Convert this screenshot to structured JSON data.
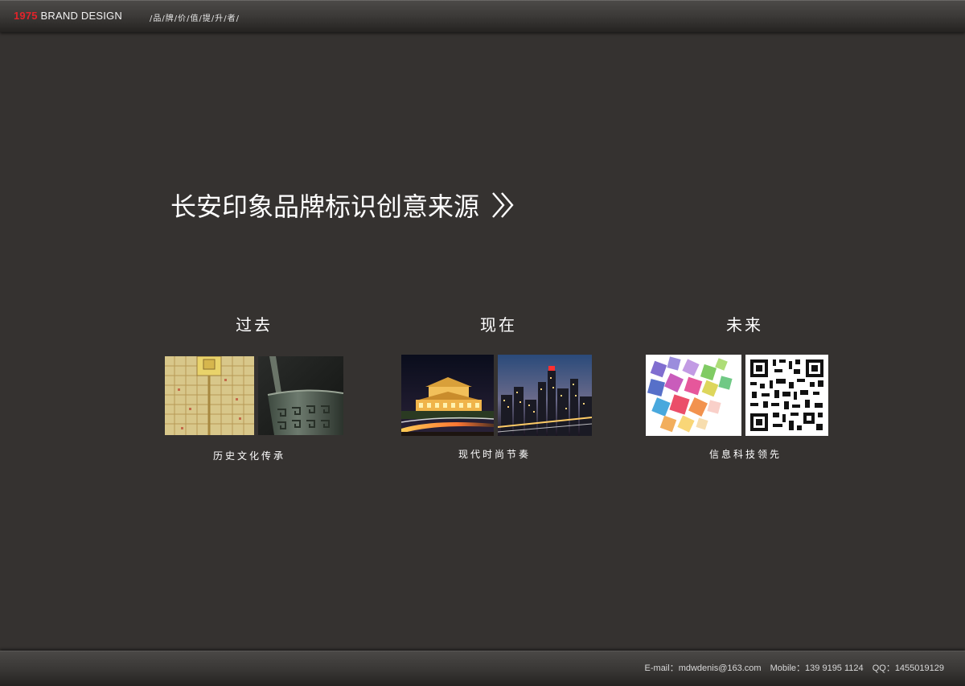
{
  "header": {
    "brand_year": "1975",
    "brand_name": "BRAND DESIGN",
    "tagline": "/品/牌/价/值/提/升/者/"
  },
  "headline": {
    "text": "长安印象品牌标识创意来源",
    "arrow_icon": "double-chevron-right-icon"
  },
  "columns": [
    {
      "title": "过去",
      "caption": "历史文化传承"
    },
    {
      "title": "现在",
      "caption": "现代时尚节奏"
    },
    {
      "title": "未来",
      "caption": "信息科技领先"
    }
  ],
  "footer": {
    "email": "E-mail：mdwdenis@163.com",
    "mobile": "Mobile：139 9195 1124",
    "qq": "QQ：1455019129"
  },
  "colors": {
    "background": "#353230",
    "accent": "#e2232a"
  }
}
